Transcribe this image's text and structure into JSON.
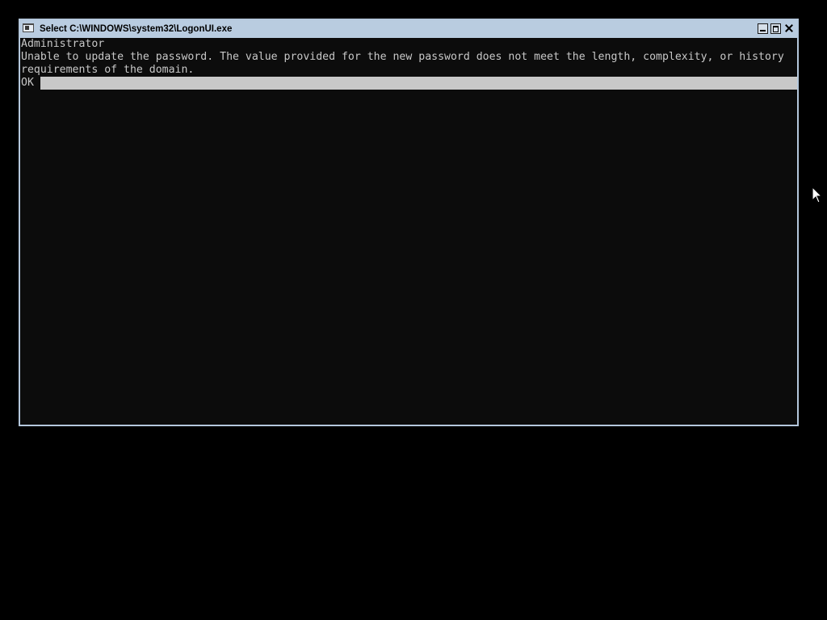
{
  "window": {
    "title": "Select C:\\WINDOWS\\system32\\LogonUI.exe",
    "icon": "console-window-icon",
    "controls": [
      "minimize-icon",
      "maximize-icon",
      "close-icon"
    ]
  },
  "console": {
    "user_line": "Administrator",
    "message_line_1": "Unable to update the password. The value provided for the new password does not meet the length, complexity, or history",
    "message_line_2": "requirements of the domain.",
    "ok_label": "OK"
  },
  "colors": {
    "desktop_background": "#000000",
    "console_background": "#0c0c0c",
    "console_text": "#c8c8c8",
    "title_bar": "#b9cce0",
    "selection_bar": "#c8c8c8"
  }
}
